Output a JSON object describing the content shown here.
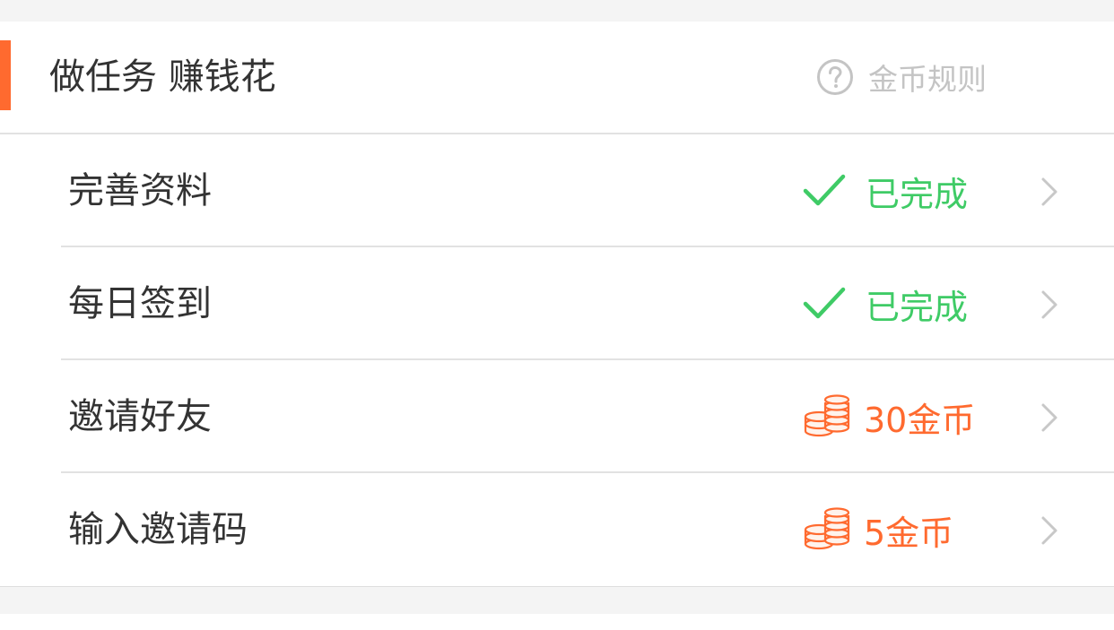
{
  "header": {
    "title": "做任务 赚钱花",
    "rules_label": "金币规则",
    "accent_color": "#ff6a2f"
  },
  "tasks": [
    {
      "label": "完善资料",
      "status": "已完成",
      "status_type": "done",
      "icon": "check-icon"
    },
    {
      "label": "每日签到",
      "status": "已完成",
      "status_type": "done",
      "icon": "check-icon"
    },
    {
      "label": "邀请好友",
      "status": "30金币",
      "status_type": "coins",
      "icon": "coin-stack-icon"
    },
    {
      "label": "输入邀请码",
      "status": "5金币",
      "status_type": "coins",
      "icon": "coin-stack-icon"
    }
  ],
  "colors": {
    "done": "#3fcb66",
    "coins": "#ff6a2f",
    "chevron": "#c8c8c8",
    "muted": "#c4c4c4"
  }
}
